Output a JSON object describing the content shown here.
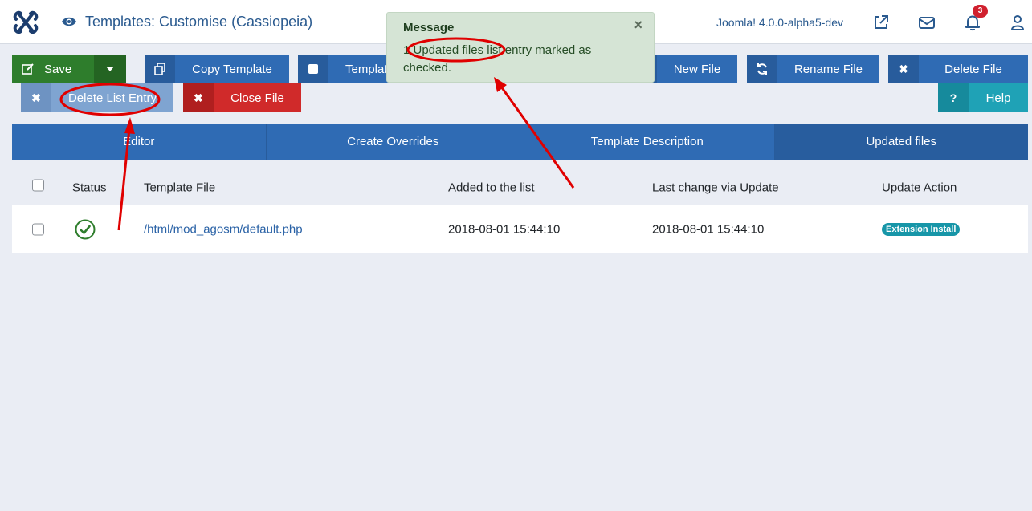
{
  "header": {
    "title": "Templates: Customise (Cassiopeia)",
    "version": "Joomla! 4.0.0-alpha5-dev",
    "notification_count": "3"
  },
  "toolbar": {
    "save_label": "Save",
    "copy_template_label": "Copy Template",
    "template_preview_label": "Templat",
    "new_file_label": "New File",
    "rename_file_label": "Rename File",
    "delete_file_label": "Delete File",
    "delete_list_entry_label": "Delete List Entry",
    "close_file_label": "Close File",
    "help_label": "Help"
  },
  "tabs": [
    {
      "label": "Editor"
    },
    {
      "label": "Create Overrides"
    },
    {
      "label": "Template Description"
    },
    {
      "label": "Updated files"
    }
  ],
  "table": {
    "columns": [
      "Status",
      "Template File",
      "Added to the list",
      "Last change via Update",
      "Update Action"
    ],
    "rows": [
      {
        "template_file": "/html/mod_agosm/default.php",
        "added": "2018-08-01 15:44:10",
        "last_change": "2018-08-01 15:44:10",
        "update_action": "Extension Install"
      }
    ]
  },
  "message": {
    "title": "Message",
    "text": "1 Updated files list entry marked as checked.",
    "close": "×"
  },
  "colors": {
    "primary": "#2f6bb4",
    "success": "#2e7d2c",
    "danger": "#d02a2a",
    "info": "#1fa2b6",
    "annotation": "#e00000"
  }
}
